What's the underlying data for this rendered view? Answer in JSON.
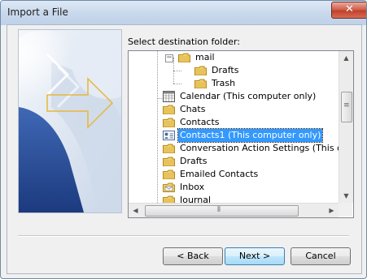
{
  "window": {
    "title": "Import a File",
    "close_glyph": "✕"
  },
  "destination_label": "Select destination folder:",
  "tree": {
    "items": [
      {
        "label": "mail",
        "icon": "folder-icon",
        "expander": "−"
      },
      {
        "label": "Drafts",
        "icon": "folder-icon"
      },
      {
        "label": "Trash",
        "icon": "folder-icon"
      },
      {
        "label": "Calendar (This computer only)",
        "icon": "calendar-icon"
      },
      {
        "label": "Chats",
        "icon": "folder-icon"
      },
      {
        "label": "Contacts",
        "icon": "folder-icon"
      },
      {
        "label": "Contacts1 (This computer only)",
        "icon": "contact-card-icon",
        "selected": true
      },
      {
        "label": "Conversation Action Settings (This c",
        "icon": "folder-icon"
      },
      {
        "label": "Drafts",
        "icon": "folder-icon"
      },
      {
        "label": "Emailed Contacts",
        "icon": "folder-icon"
      },
      {
        "label": "Inbox",
        "icon": "inbox-icon"
      },
      {
        "label": "Journal",
        "icon": "journal-icon"
      }
    ]
  },
  "buttons": {
    "back": "< Back",
    "next": "Next >",
    "cancel": "Cancel"
  },
  "colors": {
    "selection": "#3399ff",
    "folder": "#e8c25a",
    "banner_blue": "#2a4f9a",
    "arrow_gold": "#e7b73a"
  }
}
